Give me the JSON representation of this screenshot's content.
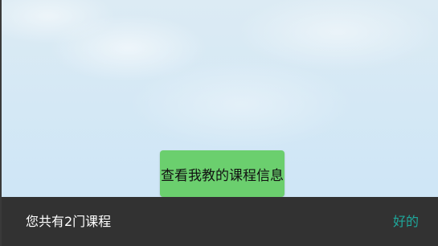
{
  "main": {
    "action_button_label": "查看我教的课程信息"
  },
  "snackbar": {
    "message": "您共有2门课程",
    "action_label": "好的"
  },
  "colors": {
    "button_bg": "#6bcf6e",
    "snackbar_bg": "#323232",
    "snackbar_action": "#1ea79b",
    "background_sky": "#d4e8f5"
  }
}
